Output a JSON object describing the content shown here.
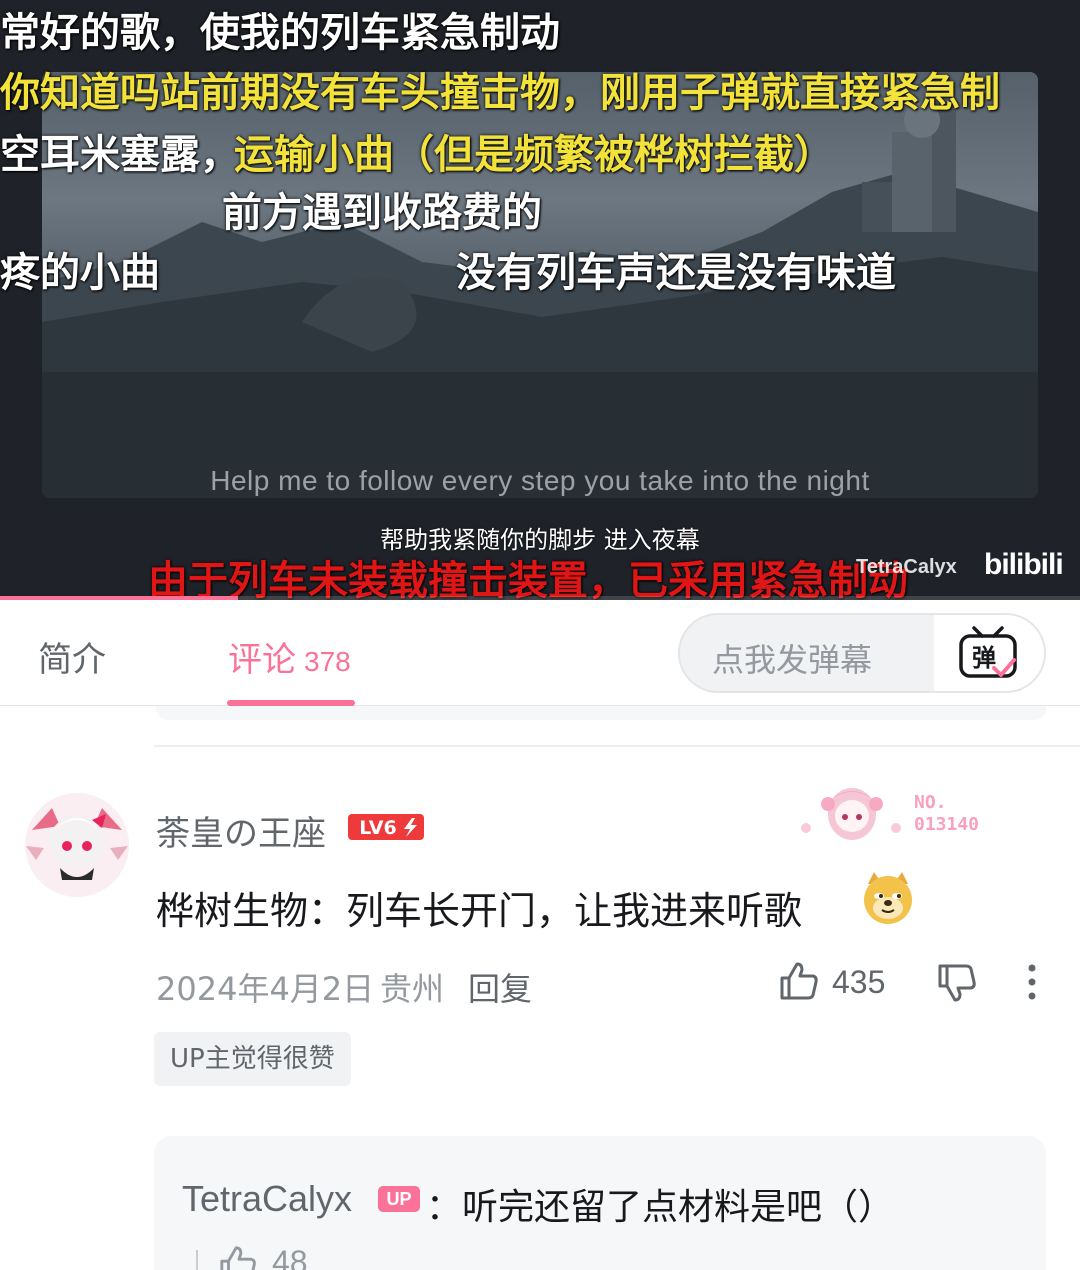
{
  "player": {
    "danmaku": [
      "常好的歌，使我的列车紧急制动",
      "你知道吗站前期没有车头撞击物，刚用子弹就直接紧急制",
      "空耳米塞露，",
      "运输小曲（但是频繁被桦树拦截）",
      "前方遇到收路费的",
      "疼的小曲",
      "没有列车声还是没有味道",
      "由于列车未装载撞击装置，已采用紧急制动"
    ],
    "subtitle_en": "Help me to follow every step you take into the night",
    "subtitle_zh": "帮助我紧随你的脚步 进入夜幕",
    "watermark": "TetraCalyx",
    "site_logo": "bilibili",
    "progress": 0.22
  },
  "tabs": {
    "intro": "简介",
    "comments": "评论",
    "comments_count": "378",
    "danmaku_placeholder": "点我发弹幕",
    "danmaku_icon_char": "弹"
  },
  "comment": {
    "username": "荼皇の王座",
    "level": "LV6",
    "fan_no_label": "NO.",
    "fan_no": "013140",
    "text": "桦树生物：列车长开门，让我进来听歌",
    "date": "2024年4月2日",
    "region": "贵州",
    "reply_label": "回复",
    "likes": "435",
    "up_tag": "UP主觉得很赞"
  },
  "reply": {
    "username": "TetraCalyx",
    "badge": "UP",
    "text": "：听完还留了点材料是吧（）",
    "likes": "48"
  },
  "colors": {
    "accent": "#fb7299",
    "danmaku_yellow": "#f2e23a",
    "danmaku_red": "#e01515",
    "text_secondary": "#61666d",
    "text_muted": "#9499a0"
  },
  "icons": {
    "like": "thumbs-up-icon",
    "dislike": "thumbs-down-icon",
    "more": "more-vertical-icon",
    "danmaku_toggle": "danmaku-toggle-icon",
    "emoji": "doge-emoji-icon"
  }
}
